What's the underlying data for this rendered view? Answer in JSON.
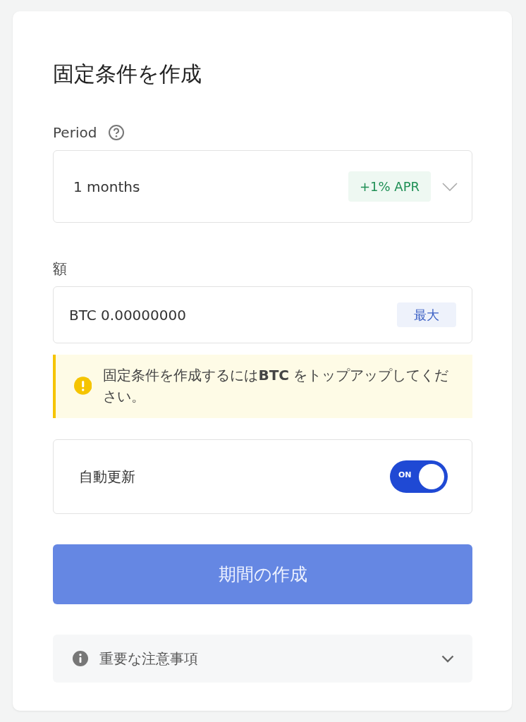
{
  "title": "固定条件を作成",
  "period": {
    "label": "Period",
    "value": "1 months",
    "badge": "+1% APR"
  },
  "amount": {
    "label": "額",
    "value": "BTC 0.00000000",
    "max_button": "最大"
  },
  "notice": {
    "text": "固定条件を作成するには**BTC** をトップアップしてください。"
  },
  "auto_renew": {
    "label": "自動更新",
    "on": true,
    "toggle_text": "ON"
  },
  "submit": {
    "label": "期間の作成",
    "disabled": true
  },
  "accordion": {
    "label": "重要な注意事項",
    "expanded": false
  }
}
